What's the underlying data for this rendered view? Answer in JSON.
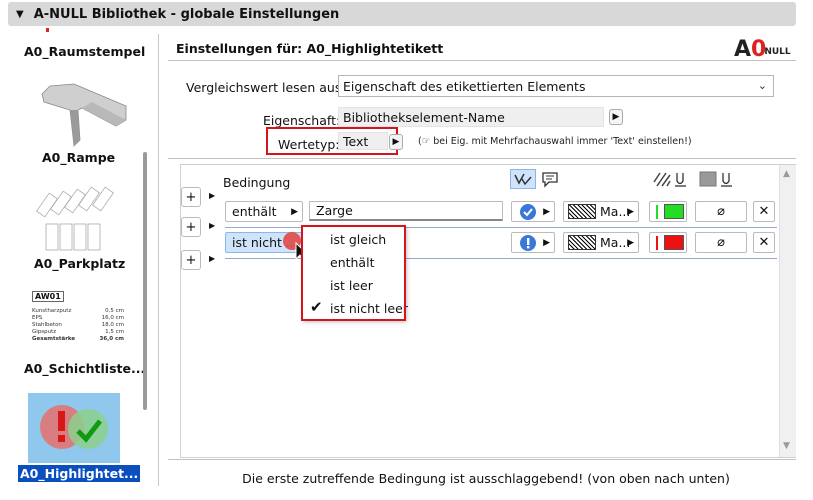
{
  "window": {
    "title": "A-NULL Bibliothek - globale Einstellungen"
  },
  "sidebar": {
    "items": [
      {
        "label": "A0_Raumstempel"
      },
      {
        "label": "A0_Rampe"
      },
      {
        "label": "A0_Parkplatz"
      },
      {
        "label": "A0_Schichtliste..."
      },
      {
        "label": "A0_Highlightet..."
      }
    ],
    "schicht_thumb": {
      "tag": "AW01",
      "rows": [
        {
          "name": "Kunstharzputz",
          "val": "0,5 cm"
        },
        {
          "name": "EPS",
          "val": "16,0 cm"
        },
        {
          "name": "Stahlbeton",
          "val": "18,0 cm"
        },
        {
          "name": "Gipsputz",
          "val": "1,5 cm"
        },
        {
          "name": "Gesamtstärke",
          "val": "36,0 cm"
        }
      ]
    }
  },
  "main": {
    "settings_for": "Einstellungen für: A0_Highlightetikett",
    "logo": {
      "a": "A",
      "o": "0",
      "null": "NULL"
    },
    "compare_label": "Vergleichswert lesen aus:",
    "compare_value": "Eigenschaft des etikettierten Elements",
    "property_label": "Eigenschaft:",
    "property_value": "Bibliothekselement-Name",
    "valuetype_label": "Wertetyp:",
    "valuetype_value": "Text",
    "hint": "(☞ bei Eig. mit Mehrfachauswahl immer 'Text' einstellen!)",
    "condition_header": "Bedingung",
    "rows": [
      {
        "op": "enthält",
        "value": "Zarge",
        "pattern": "Ma...",
        "color": "#22dd22"
      },
      {
        "op": "ist nicht ...",
        "value": "",
        "pattern": "Ma...",
        "color": "#ee1111"
      }
    ],
    "dropdown_options": [
      "ist gleich",
      "enthält",
      "ist leer",
      "ist nicht leer"
    ],
    "footer": "Die erste zutreffende Bedingung ist ausschlaggebend! (von oben nach unten)"
  },
  "colors": {
    "selection": "#0b4fbf",
    "highlight_red": "#d4151b",
    "accent_blue": "#3a78d8"
  }
}
